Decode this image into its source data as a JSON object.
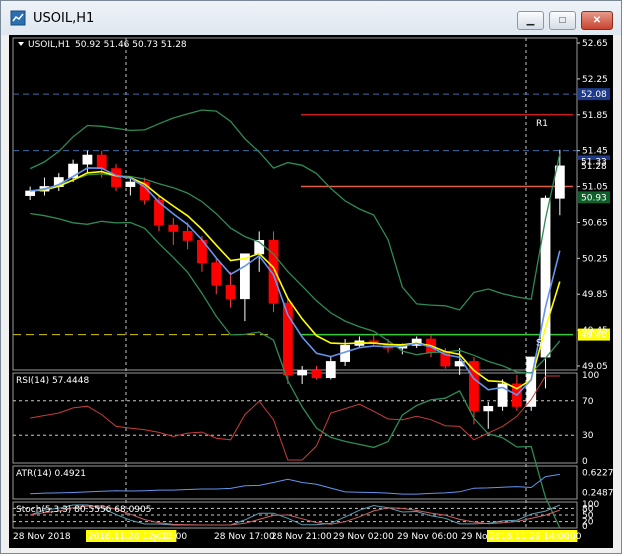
{
  "window": {
    "title": "USOIL,H1",
    "controls": [
      "minimize",
      "maximize",
      "close"
    ]
  },
  "chart": {
    "symbol": "USOIL,H1",
    "ohlc": "50.92 51.46 50.73 51.28",
    "price_labels": [
      "52.65",
      "52.25",
      "51.85",
      "51.45",
      "51.05",
      "50.65",
      "50.25",
      "49.85",
      "49.45",
      "49.05"
    ],
    "tags": [
      {
        "label": "52.08",
        "price": 52.08,
        "bg": "#1e3a8a",
        "fg": "#ffffff"
      },
      {
        "label": "51.33",
        "price": 51.33,
        "bg": "#1e3a8a",
        "fg": "#ffffff"
      },
      {
        "label": "51.28",
        "price": 51.28,
        "bg": "#000000",
        "fg": "#ffffff"
      },
      {
        "label": "50.93",
        "price": 50.93,
        "bg": "#0f5f2a",
        "fg": "#ffffff"
      },
      {
        "label": "49.40",
        "price": 49.4,
        "bg": "#ffff00",
        "fg": "#000000"
      }
    ],
    "level_labels": {
      "r1": "R1",
      "s1": "S1"
    },
    "colors": {
      "bull": "#ffffff",
      "bear": "#ff0000",
      "bollinger": "#2e8b57",
      "ema_fast": "#ffff00",
      "ema_slow": "#6495ed",
      "r1": "#c81e1e",
      "pivot": "#e06040",
      "s1": "#32cd32",
      "blue_dash": "#3c6ea8",
      "grid": "#b0b0b0"
    }
  },
  "chart_data": {
    "type": "candlestick",
    "title": "USOIL,H1",
    "ylim": [
      49.05,
      52.65
    ],
    "candles": [
      [
        50.95,
        51.05,
        50.9,
        51.0
      ],
      [
        51.0,
        51.15,
        50.95,
        51.05
      ],
      [
        51.05,
        51.2,
        51.0,
        51.15
      ],
      [
        51.15,
        51.35,
        51.1,
        51.3
      ],
      [
        51.3,
        51.45,
        51.2,
        51.4
      ],
      [
        51.4,
        51.45,
        51.15,
        51.25
      ],
      [
        51.25,
        51.3,
        51.0,
        51.05
      ],
      [
        51.05,
        51.15,
        50.95,
        51.1
      ],
      [
        51.1,
        51.15,
        50.85,
        50.9
      ],
      [
        50.9,
        50.95,
        50.55,
        50.62
      ],
      [
        50.62,
        50.7,
        50.4,
        50.55
      ],
      [
        50.55,
        50.65,
        50.35,
        50.45
      ],
      [
        50.45,
        50.5,
        50.1,
        50.2
      ],
      [
        50.2,
        50.25,
        49.85,
        49.95
      ],
      [
        49.95,
        50.1,
        49.7,
        49.8
      ],
      [
        49.8,
        50.3,
        49.55,
        50.3
      ],
      [
        50.3,
        50.55,
        50.1,
        50.45
      ],
      [
        50.45,
        50.55,
        49.65,
        49.75
      ],
      [
        49.75,
        49.8,
        48.85,
        48.95
      ],
      [
        48.95,
        49.05,
        48.85,
        49.0
      ],
      [
        49.0,
        49.05,
        48.9,
        48.92
      ],
      [
        48.92,
        49.15,
        48.9,
        49.1
      ],
      [
        49.1,
        49.35,
        49.05,
        49.28
      ],
      [
        49.28,
        49.38,
        49.25,
        49.33
      ],
      [
        49.33,
        49.4,
        49.28,
        49.3
      ],
      [
        49.3,
        49.35,
        49.2,
        49.25
      ],
      [
        49.25,
        49.3,
        49.18,
        49.28
      ],
      [
        49.28,
        49.38,
        49.25,
        49.35
      ],
      [
        49.35,
        49.4,
        49.15,
        49.2
      ],
      [
        49.2,
        49.25,
        49.02,
        49.05
      ],
      [
        49.05,
        49.25,
        48.95,
        49.1
      ],
      [
        49.1,
        49.15,
        48.4,
        48.55
      ],
      [
        48.55,
        48.65,
        48.35,
        48.6
      ],
      [
        48.6,
        48.9,
        48.55,
        48.85
      ],
      [
        48.85,
        48.95,
        48.55,
        48.6
      ],
      [
        48.6,
        49.15,
        48.55,
        49.15
      ],
      [
        49.15,
        50.95,
        48.8,
        50.92
      ],
      [
        50.92,
        51.46,
        50.73,
        51.28
      ]
    ],
    "levels": {
      "r1": 51.85,
      "pivot": 51.05,
      "s1": 49.4,
      "blue_dash_1": 52.08,
      "blue_dash_2": 51.45,
      "yellow_dash": 49.4
    },
    "indicators": [
      {
        "label": "RSI(14) 57.4448",
        "levels": [
          "70",
          "30"
        ],
        "scale": [
          "100",
          "70",
          "30",
          "0"
        ]
      },
      {
        "label": "ATR(14) 0.4921",
        "scale": [
          "0.6227",
          "0.2487"
        ]
      },
      {
        "label": "Stoch(5,3,3) 80.5556 68.0905",
        "scale": [
          "100",
          "80",
          "50",
          "20",
          "0"
        ]
      }
    ],
    "time_labels": [
      "28 Nov 2018",
      "2018.11.28 12:00",
      "y 13:00",
      "28 Nov 17:00",
      "28 Nov 21:00",
      "29 Nov 02:00",
      "29 Nov 06:00",
      "29 No",
      "2018.11.29 14:00",
      ":00"
    ]
  }
}
